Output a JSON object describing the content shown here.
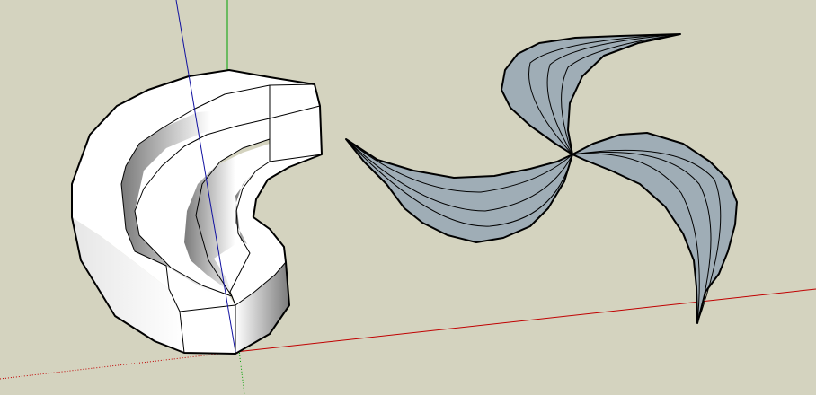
{
  "canvas": {
    "background_color": "#d4d3bf",
    "edge_color": "#000000",
    "ghost_edge_color": "#9a9a90"
  },
  "axes": {
    "red_axis_color": "#c00000",
    "green_axis_color": "#00a000",
    "blue_axis_color": "#1010a0"
  },
  "models": {
    "crescent_solid": {
      "face_color": "#ffffff",
      "shade_light": "#e6e6e6",
      "shade_dark": "#7a7a7a"
    },
    "three_blade_surface": {
      "face_color": "#9fadb6"
    }
  }
}
